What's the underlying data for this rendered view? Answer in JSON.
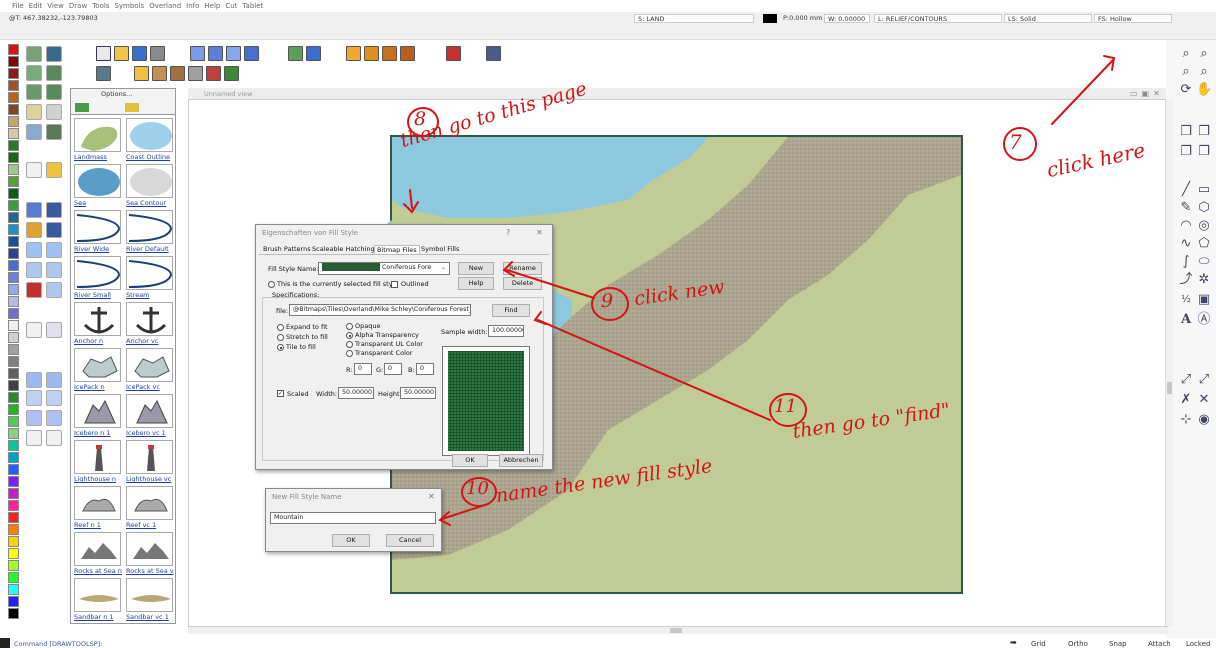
{
  "menubar": {
    "items": [
      "File",
      "Edit",
      "View",
      "Draw",
      "Tools",
      "Symbols",
      "Overland",
      "Info",
      "Help",
      "Cut",
      "Tablet"
    ]
  },
  "statusbar": {
    "coords": "@T: 467.38232,-123.79803",
    "sheet": "S: LAND",
    "pen": "P:0.000 mm",
    "width": "W: 0.00000",
    "layer": "L: RELIEF/CONTOURS",
    "line_style": "LS: Solid",
    "fill_style": "FS: Hollow"
  },
  "colors": {
    "palette": [
      "#d41414",
      "#7a0a0a",
      "#8b1a1a",
      "#a0522d",
      "#b5651d",
      "#7b4a24",
      "#c8a46a",
      "#d9c9a8",
      "#2a7a2a",
      "#196619",
      "#9ec98a",
      "#5a9e3a",
      "#0b5e1e",
      "#3a9e3a",
      "#1f6b8f",
      "#1e90c8",
      "#1a4fa0",
      "#304090",
      "#4a6ed0",
      "#6a82d8",
      "#9aa8e8",
      "#b8b8e8",
      "#7070c8",
      "#f0f0f0",
      "#d0d0d0",
      "#a0a0a0",
      "#808080",
      "#606060",
      "#404040",
      "#2a8a2a",
      "#22b222",
      "#55c855",
      "#8ad08a",
      "#00c8a0",
      "#00a0c8",
      "#2060ff",
      "#7a20ff",
      "#c020c8",
      "#ff20a0",
      "#ff2020",
      "#ff8000",
      "#ffd000",
      "#ffff00",
      "#a0ff20",
      "#20ff20",
      "#20ffff",
      "#2020ff",
      "#000000"
    ],
    "sea": "#8ec8df",
    "land": "#c1cb96",
    "mountain": "#a9a28d",
    "map_border": "#2f5a45",
    "annotation": "#d41414"
  },
  "symbols": {
    "options_label": "Options...",
    "items": [
      {
        "label": "Landmass",
        "kind": "landmass"
      },
      {
        "label": "Coast Outline",
        "kind": "coast"
      },
      {
        "label": "Sea",
        "kind": "sea"
      },
      {
        "label": "Sea Contour",
        "kind": "seacontour"
      },
      {
        "label": "River Wide",
        "kind": "river"
      },
      {
        "label": "River Default",
        "kind": "river"
      },
      {
        "label": "River Small",
        "kind": "river"
      },
      {
        "label": "Stream",
        "kind": "river"
      },
      {
        "label": "Anchor n",
        "kind": "anchor"
      },
      {
        "label": "Anchor vc",
        "kind": "anchor"
      },
      {
        "label": "IcePack n",
        "kind": "ice"
      },
      {
        "label": "IcePack vc",
        "kind": "ice"
      },
      {
        "label": "Icebero n 1",
        "kind": "berg"
      },
      {
        "label": "Icebero vc 1",
        "kind": "berg"
      },
      {
        "label": "Lighthouse n",
        "kind": "lighthouse"
      },
      {
        "label": "Lighthouse vc",
        "kind": "lighthouse"
      },
      {
        "label": "Reef n 1",
        "kind": "reef"
      },
      {
        "label": "Reef vc 1",
        "kind": "reef"
      },
      {
        "label": "Rocks at Sea n",
        "kind": "rocks"
      },
      {
        "label": "Rocks at Sea v",
        "kind": "rocks"
      },
      {
        "label": "Sandbar n 1",
        "kind": "sandbar"
      },
      {
        "label": "Sandbar vc 1",
        "kind": "sandbar"
      }
    ]
  },
  "map_window": {
    "title": "Unnamed view"
  },
  "fill_dialog": {
    "title": "Eigenschaften von Fill Style",
    "help_glyph": "?",
    "close_glyph": "✕",
    "tabs": [
      "Brush Patterns",
      "Scaleable Hatching",
      "Bitmap Files",
      "Symbol Fills"
    ],
    "fill_style_name_label": "Fill Style Name:",
    "fill_style_name_value": "Coniferous Fore",
    "new_button": "New",
    "rename_button": "Rename",
    "delete_button": "Delete",
    "help_button": "Help",
    "current_fill_label": "This is the currently selected fill style",
    "outlined_label": "Outlined",
    "specifications_label": "Specifications:",
    "file_label": "file:",
    "file_value": "@Bitmaps\\Tiles\\Overland\\Mike Schley\\Coniferous Forest_VH.F",
    "find_button": "Find",
    "expand_label": "Expand to fit",
    "stretch_label": "Stretch to fill",
    "tile_label": "Tile to fill",
    "opaque_label": "Opaque",
    "alpha_label": "Alpha Transparency",
    "transparent_ul_label": "Transparent UL Color",
    "transparent_color_label": "Transparent Color",
    "r_label": "R:",
    "r_value": "0",
    "g_label": "G:",
    "g_value": "0",
    "b_label": "B:",
    "b_value": "0",
    "sample_width_label": "Sample width:",
    "sample_width_value": "100.00000",
    "scaled_label": "Scaled",
    "width_label": "Width:",
    "width_value": "50.00000",
    "height_label": "Height:",
    "height_value": "50.00000",
    "ok_button": "OK",
    "cancel_button": "Abbrechen"
  },
  "new_name_dialog": {
    "title": "New Fill Style Name",
    "close_glyph": "✕",
    "value": "Mountain",
    "ok_button": "OK",
    "cancel_button": "Cancel"
  },
  "annotations": {
    "n7": "7",
    "a7": "click here",
    "n8": "8",
    "a8": "then go to this page",
    "n9": "9",
    "a9": "click new",
    "n10": "10",
    "a10": "name the new fill style",
    "n11": "11",
    "a11": "then go to \"find\""
  },
  "command_line": "Command [DRAWTOOLSP]:",
  "bottom_buttons": [
    "Grid",
    "Ortho",
    "Snap",
    "Attach",
    "Locked"
  ]
}
